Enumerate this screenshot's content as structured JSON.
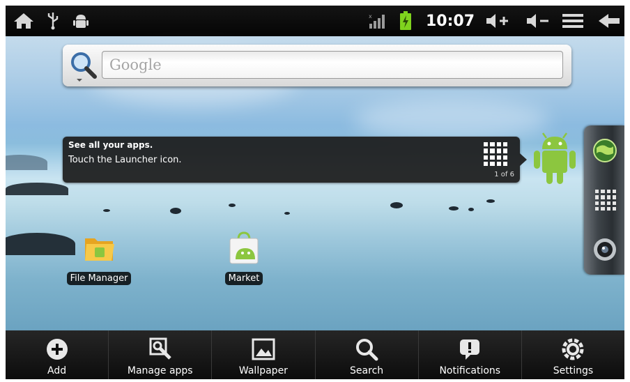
{
  "status_bar": {
    "time": "10:07",
    "icons": [
      "home-icon",
      "usb-icon",
      "android-debug-icon",
      "signal-icon",
      "battery-charging-icon",
      "volume-up-icon",
      "volume-down-icon",
      "menu-icon",
      "back-icon"
    ]
  },
  "search": {
    "placeholder": "Google",
    "icon": "search-icon"
  },
  "tooltip": {
    "title": "See all your apps.",
    "body": "Touch the Launcher icon.",
    "page": "1 of 6"
  },
  "desktop": {
    "apps": [
      {
        "label": "File Manager",
        "icon": "folder-icon"
      },
      {
        "label": "Market",
        "icon": "market-icon"
      }
    ]
  },
  "dock": {
    "items": [
      "browser-globe-icon",
      "launcher-grid-icon",
      "camera-icon"
    ]
  },
  "menu": {
    "items": [
      {
        "label": "Add",
        "icon": "add-icon"
      },
      {
        "label": "Manage apps",
        "icon": "manage-apps-icon"
      },
      {
        "label": "Wallpaper",
        "icon": "wallpaper-icon"
      },
      {
        "label": "Search",
        "icon": "search-icon"
      },
      {
        "label": "Notifications",
        "icon": "notifications-icon"
      },
      {
        "label": "Settings",
        "icon": "settings-icon"
      }
    ]
  },
  "colors": {
    "status_bar": "#0a0a0a",
    "battery": "#7fd31e",
    "android_green": "#8cc63f",
    "menu_bar": "#1a1a1a"
  }
}
